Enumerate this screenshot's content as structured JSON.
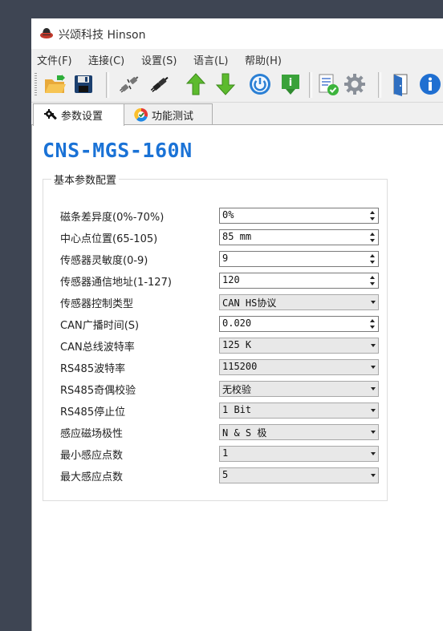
{
  "window": {
    "title": "兴颂科技 Hinson"
  },
  "menu": [
    "文件(F)",
    "连接(C)",
    "设置(S)",
    "语言(L)",
    "帮助(H)"
  ],
  "toolbar_icons": [
    "open-folder-icon",
    "save-icon",
    "disconnect-icon",
    "connect-icon",
    "upload-icon",
    "download-icon",
    "power-icon",
    "info-download-icon",
    "document-check-icon",
    "settings-gear-icon",
    "exit-icon",
    "info-icon"
  ],
  "tabs": [
    {
      "label": "参数设置",
      "active": true
    },
    {
      "label": "功能测试",
      "active": false
    }
  ],
  "device_title": "CNS-MGS-160N",
  "group_title": "基本参数配置",
  "params": [
    {
      "label": "磁条差异度(0%-70%)",
      "value": "0%",
      "type": "spin"
    },
    {
      "label": "中心点位置(65-105)",
      "value": "85 mm",
      "type": "spin"
    },
    {
      "label": "传感器灵敏度(0-9)",
      "value": "9",
      "type": "spin"
    },
    {
      "label": "传感器通信地址(1-127)",
      "value": "120",
      "type": "spin"
    },
    {
      "label": "传感器控制类型",
      "value": "CAN HS协议",
      "type": "combo"
    },
    {
      "label": "CAN广播时间(S)",
      "value": "0.020",
      "type": "spin"
    },
    {
      "label": "CAN总线波特率",
      "value": "125 K",
      "type": "combo"
    },
    {
      "label": "RS485波特率",
      "value": "115200",
      "type": "combo"
    },
    {
      "label": "RS485奇偶校验",
      "value": "无校验",
      "type": "combo"
    },
    {
      "label": "RS485停止位",
      "value": "1 Bit",
      "type": "combo"
    },
    {
      "label": "感应磁场极性",
      "value": "N & S 极",
      "type": "combo"
    },
    {
      "label": "最小感应点数",
      "value": "1",
      "type": "combo"
    },
    {
      "label": "最大感应点数",
      "value": "5",
      "type": "combo"
    }
  ],
  "colors": {
    "accent": "#1a72d6",
    "desktop": "#3e4553"
  }
}
